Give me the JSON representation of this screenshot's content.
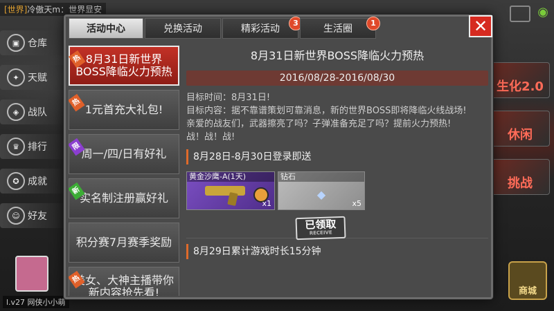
{
  "chat": {
    "channel": "[世界]",
    "message": "冷傲天m：世界显安"
  },
  "side_menu": [
    {
      "label": "仓库",
      "icon": "box-icon"
    },
    {
      "label": "天赋",
      "icon": "talent-icon"
    },
    {
      "label": "战队",
      "icon": "team-icon"
    },
    {
      "label": "排行",
      "icon": "rank-icon"
    },
    {
      "label": "成就",
      "icon": "trophy-icon"
    },
    {
      "label": "好友",
      "icon": "friends-icon"
    }
  ],
  "player": {
    "level": "27",
    "name": "网侠小小萌",
    "label": "l.v27 网侠小小萌"
  },
  "right_panel": [
    {
      "label": "生化2.0"
    },
    {
      "label": "休闲"
    },
    {
      "label": "挑战"
    }
  ],
  "shop": {
    "label": "商城"
  },
  "tabs": [
    {
      "label": "活动中心",
      "active": true,
      "badge": ""
    },
    {
      "label": "兑换活动",
      "active": false,
      "badge": ""
    },
    {
      "label": "精彩活动",
      "active": false,
      "badge": "3"
    },
    {
      "label": "生活圈",
      "active": false,
      "badge": "1"
    }
  ],
  "close_label": "✕",
  "list": [
    {
      "label": "8月31日新世界BOSS降临火力预热",
      "tag": "热",
      "tag_type": "hot",
      "active": true
    },
    {
      "label": "1元首充大礼包!",
      "tag": "热",
      "tag_type": "hot",
      "active": false
    },
    {
      "label": "周一/四/日有好礼",
      "tag": "限",
      "tag_type": "purple",
      "active": false
    },
    {
      "label": "实名制注册赢好礼",
      "tag": "新",
      "tag_type": "new",
      "active": false
    },
    {
      "label": "积分赛7月赛季奖励",
      "tag": "",
      "tag_type": "",
      "active": false
    },
    {
      "label": "美女、大神主播带你新内容抢先看!",
      "tag": "热",
      "tag_type": "hot",
      "active": false
    }
  ],
  "detail": {
    "title": "8月31日新世界BOSS降临火力预热",
    "date": "2016/08/28-2016/08/30",
    "lines": [
      "目标时间：8月31日!",
      "目标内容：据不靠谱策划可靠消息，新的世界BOSS即将降临火线战场!",
      "亲爱的战友们，武器擦亮了吗？子弹准备充足了吗？提前火力预热!",
      "战！战！战!"
    ],
    "section1": "8月28日-8月30日登录即送",
    "rewards": [
      {
        "name": "黄金沙鹰-A(1天)",
        "qty": "x1",
        "color": "#7b4fc2"
      },
      {
        "name": "钻石",
        "qty": "x5",
        "color": "#a9a9a9"
      }
    ],
    "claimed_label": "已领取",
    "claimed_sub": "RECEIVE",
    "section2": "8月29日累计游戏时长15分钟"
  }
}
